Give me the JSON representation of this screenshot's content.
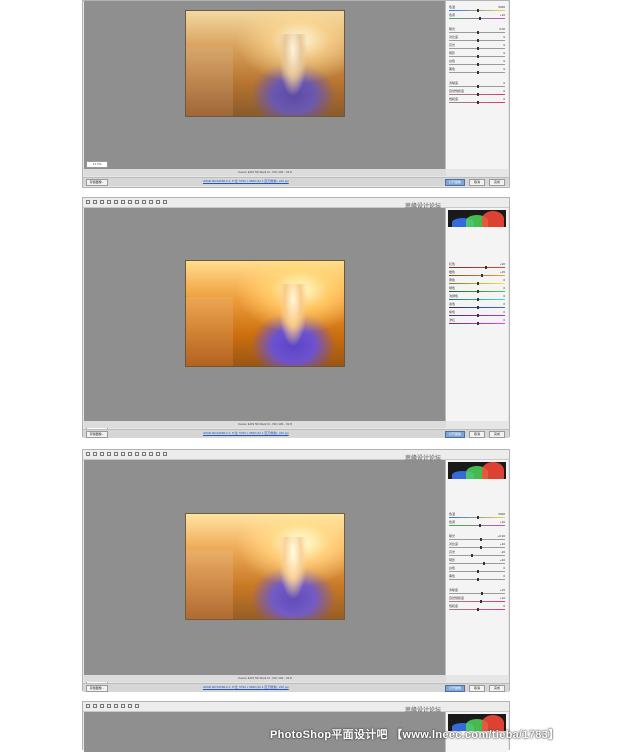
{
  "frames": [
    {
      "zoom": "17.7%",
      "status_text": "Canon EOS 5D Mark III - ISO 100 - f/2.8",
      "file_info": "sRGB IEC61966-2.1; 8 位; 5760 x 3840 (22.1 百万像素); 240 ppi",
      "buttons": {
        "save": "存储图像...",
        "open": "打开图像",
        "cancel": "取消",
        "done": "完成"
      },
      "watermark": "",
      "sliders": [
        {
          "label": "色温",
          "value": "5000"
        },
        {
          "label": "色调",
          "value": "+10"
        },
        {
          "label": "曝光",
          "value": "0.00"
        },
        {
          "label": "对比度",
          "value": "0"
        },
        {
          "label": "高光",
          "value": "0"
        },
        {
          "label": "阴影",
          "value": "0"
        },
        {
          "label": "白色",
          "value": "0"
        },
        {
          "label": "黑色",
          "value": "0"
        },
        {
          "label": "清晰度",
          "value": "0"
        },
        {
          "label": "自然饱和度",
          "value": "0"
        },
        {
          "label": "饱和度",
          "value": "0"
        }
      ]
    },
    {
      "zoom": "17.7%",
      "status_text": "Canon EOS 5D Mark III - ISO 100 - f/2.8",
      "file_info": "sRGB IEC61966-2.1; 8 位; 5760 x 3840 (22.1 百万像素); 240 ppi",
      "buttons": {
        "save": "存储图像...",
        "open": "打开图像",
        "cancel": "取消",
        "done": "完成"
      },
      "watermark": "思缘设计论坛",
      "sliders": [
        {
          "label": "红色",
          "value": "+30"
        },
        {
          "label": "橙色",
          "value": "+15"
        },
        {
          "label": "黄色",
          "value": "0"
        },
        {
          "label": "绿色",
          "value": "0"
        },
        {
          "label": "浅绿色",
          "value": "0"
        },
        {
          "label": "蓝色",
          "value": "0"
        },
        {
          "label": "紫色",
          "value": "0"
        },
        {
          "label": "洋红",
          "value": "0"
        }
      ]
    },
    {
      "zoom": "17.7%",
      "status_text": "Canon EOS 5D Mark III - ISO 100 - f/2.8",
      "file_info": "sRGB IEC61966-2.1; 8 位; 5760 x 3840 (22.1 百万像素); 240 ppi",
      "buttons": {
        "save": "存储图像...",
        "open": "打开图像",
        "cancel": "取消",
        "done": "完成"
      },
      "watermark": "思缘设计论坛",
      "sliders": [
        {
          "label": "色温",
          "value": "5000"
        },
        {
          "label": "色调",
          "value": "+10"
        },
        {
          "label": "曝光",
          "value": "+0.30"
        },
        {
          "label": "对比度",
          "value": "+10"
        },
        {
          "label": "高光",
          "value": "-20"
        },
        {
          "label": "阴影",
          "value": "+20"
        },
        {
          "label": "白色",
          "value": "0"
        },
        {
          "label": "黑色",
          "value": "0"
        },
        {
          "label": "清晰度",
          "value": "+15"
        },
        {
          "label": "自然饱和度",
          "value": "+10"
        },
        {
          "label": "饱和度",
          "value": "0"
        }
      ]
    },
    {
      "watermark": "思缘设计论坛"
    }
  ],
  "banner": "PhotoShop平面设计吧 【www.lneec.com/tieba/1783】"
}
